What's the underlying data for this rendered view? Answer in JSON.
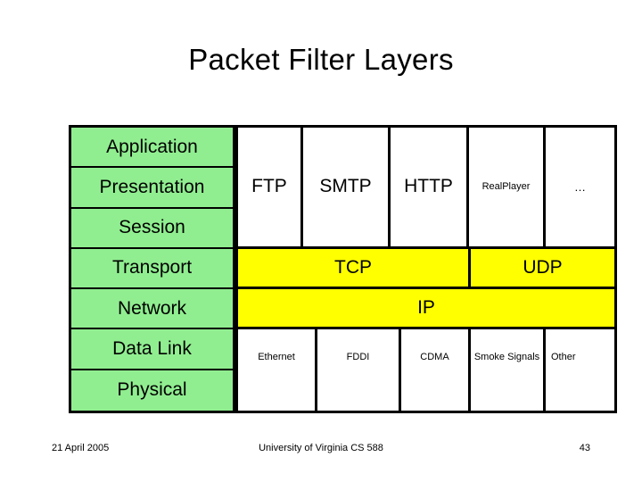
{
  "slide": {
    "title": "Packet Filter Layers"
  },
  "osi_stack": {
    "layers": [
      {
        "label": "Application"
      },
      {
        "label": "Presentation"
      },
      {
        "label": "Session"
      },
      {
        "label": "Transport"
      },
      {
        "label": "Network"
      },
      {
        "label": "Data Link"
      },
      {
        "label": "Physical"
      }
    ],
    "fill_color": "#90ee90"
  },
  "protocol_table": {
    "application_band": {
      "spans_layers": [
        "Application",
        "Presentation",
        "Session"
      ],
      "cells": [
        {
          "label": "FTP"
        },
        {
          "label": "SMTP"
        },
        {
          "label": "HTTP"
        },
        {
          "label": "RealPlayer"
        },
        {
          "label": "…"
        }
      ]
    },
    "transport_band": {
      "spans_layers": [
        "Transport"
      ],
      "fill_color": "#ffff00",
      "cells": [
        {
          "label": "TCP"
        },
        {
          "label": "UDP"
        }
      ]
    },
    "network_band": {
      "spans_layers": [
        "Network"
      ],
      "fill_color": "#ffff00",
      "cells": [
        {
          "label": "IP"
        }
      ]
    },
    "link_band": {
      "spans_layers": [
        "Data Link",
        "Physical"
      ],
      "cells": [
        {
          "label": "Ethernet"
        },
        {
          "label": "FDDI"
        },
        {
          "label": "CDMA"
        },
        {
          "label": "Smoke Signals"
        },
        {
          "label": "Other"
        }
      ]
    }
  },
  "footer": {
    "date": "21 April 2005",
    "course": "University of Virginia CS 588",
    "page_number": "43"
  }
}
